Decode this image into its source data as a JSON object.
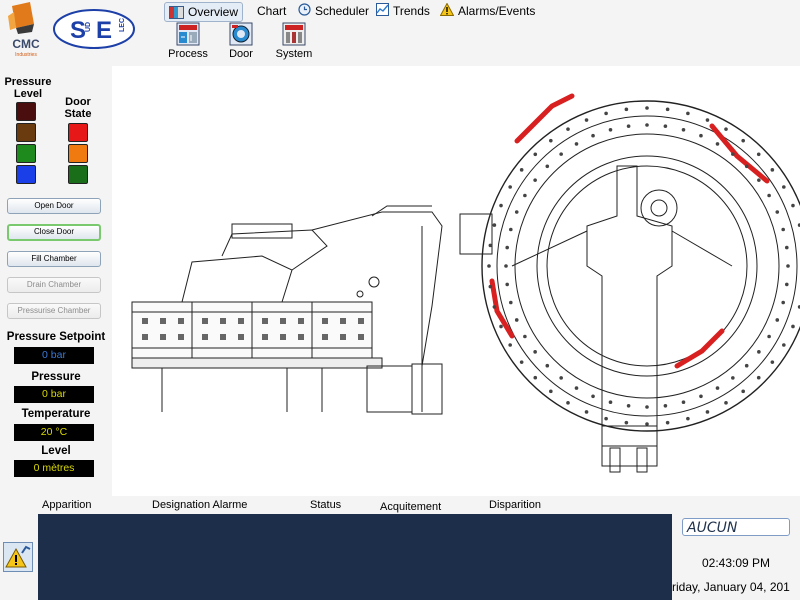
{
  "branding": {
    "cmc_logo_text": "CMC",
    "cmc_logo_subtext": "Industries",
    "sudelec_logo_text": "SuDElec"
  },
  "nav": {
    "tabs": [
      {
        "label": "Overview",
        "icon": "overview-icon",
        "active": true
      },
      {
        "label": "Chart",
        "icon": "",
        "active": false
      },
      {
        "label": "Scheduler",
        "icon": "clock-icon",
        "active": false
      },
      {
        "label": "Trends",
        "icon": "trends-icon",
        "active": false
      },
      {
        "label": "Alarms/Events",
        "icon": "warning-icon",
        "active": false
      }
    ],
    "subviews": [
      {
        "label": "Process",
        "icon": "process-icon"
      },
      {
        "label": "Door",
        "icon": "door-icon"
      },
      {
        "label": "System",
        "icon": "system-icon"
      }
    ]
  },
  "indicators": {
    "pressure_level_label": "Pressure Level",
    "door_state_label": "Door State",
    "pressure_lamps": [
      "#4a0e0e",
      "#6b3b10",
      "#1e8a1e",
      "#1a3ee8"
    ],
    "door_lamps": [
      "#e61818",
      "#f07a10",
      "#1a6e1a"
    ]
  },
  "buttons": {
    "open_door": "Open Door",
    "close_door": "Close Door",
    "fill_chamber": "Fill Chamber",
    "drain_chamber": "Drain Chamber",
    "pressurise_chamber": "Pressurise Chamber"
  },
  "readouts": {
    "pressure_setpoint_label": "Pressure Setpoint",
    "pressure_setpoint_value": "0 bar",
    "pressure_label": "Pressure",
    "pressure_value": "0 bar",
    "temperature_label": "Temperature",
    "temperature_value": "20 °C",
    "level_label": "Level",
    "level_value": "0 mètres"
  },
  "alarms": {
    "columns": [
      "Apparition",
      "Designation Alarme",
      "Status",
      "Acquitement",
      "Disparition"
    ],
    "rows": [],
    "status_box": "AUCUN",
    "ack_icon": "acknowledge-warning-icon"
  },
  "clock": {
    "time": "02:43:09 PM",
    "date": "riday, January 04, 201"
  },
  "colors": {
    "accent_red": "#d92020",
    "alarm_panel_bg": "#1c2e4a",
    "readout_text": "#d8d800"
  }
}
